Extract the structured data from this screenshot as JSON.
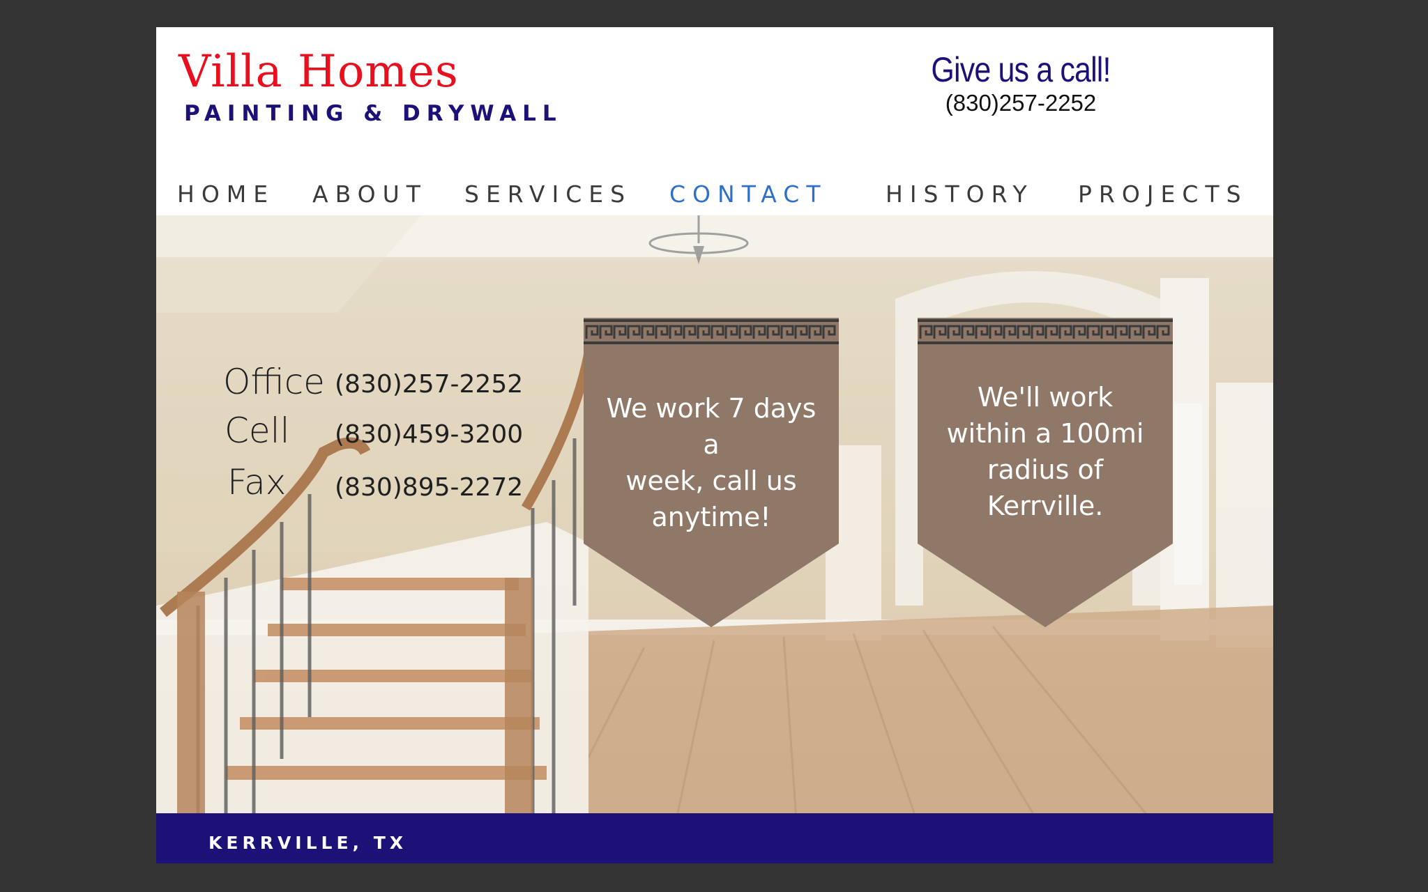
{
  "header": {
    "brand_name": "Villa Homes",
    "brand_tagline": "PAINTING & DRYWALL",
    "call_title": "Give us a call!",
    "call_phone": "(830)257-2252"
  },
  "nav": {
    "items": [
      {
        "label": "HOME"
      },
      {
        "label": "ABOUT"
      },
      {
        "label": "SERVICES"
      },
      {
        "label": "CONTACT",
        "active": true
      },
      {
        "label": "HISTORY"
      },
      {
        "label": "PROJECTS"
      }
    ]
  },
  "contacts": [
    {
      "label": "Office",
      "value": "(830)257-2252"
    },
    {
      "label": "Cell",
      "value": "(830)459-3200"
    },
    {
      "label": "Fax",
      "value": "(830)895-2272"
    }
  ],
  "banners": [
    {
      "lines": [
        "We work 7 days a",
        "week, call us",
        "anytime!"
      ]
    },
    {
      "lines": [
        "We'll work",
        "within a 100mi",
        "radius of",
        "Kerrville."
      ]
    }
  ],
  "footer": {
    "location": "KERRVILLE, TX"
  },
  "colors": {
    "brand_red": "#e8101e",
    "brand_navy": "#1c1177",
    "nav_active": "#2f6fc8",
    "banner_brown": "#8f7868",
    "page_bg": "#333333"
  },
  "icons": {
    "banner_trim": "greek-key-pattern"
  }
}
